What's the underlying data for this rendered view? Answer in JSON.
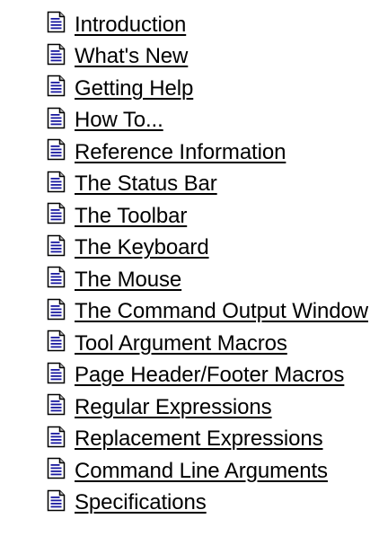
{
  "icon": "document-icon",
  "colors": {
    "background": "#ffffff",
    "link_text": "#000000",
    "icon_accent": "#1a1aa0",
    "icon_fold": "#c0c0c0"
  },
  "topics": [
    {
      "label": "Introduction"
    },
    {
      "label": "What's New"
    },
    {
      "label": "Getting Help"
    },
    {
      "label": "How To..."
    },
    {
      "label": "Reference Information"
    },
    {
      "label": "The Status Bar"
    },
    {
      "label": "The Toolbar"
    },
    {
      "label": "The Keyboard"
    },
    {
      "label": "The Mouse"
    },
    {
      "label": "The Command Output Window"
    },
    {
      "label": "Tool Argument Macros"
    },
    {
      "label": "Page Header/Footer Macros"
    },
    {
      "label": "Regular Expressions"
    },
    {
      "label": "Replacement Expressions"
    },
    {
      "label": "Command Line Arguments"
    },
    {
      "label": "Specifications"
    }
  ]
}
